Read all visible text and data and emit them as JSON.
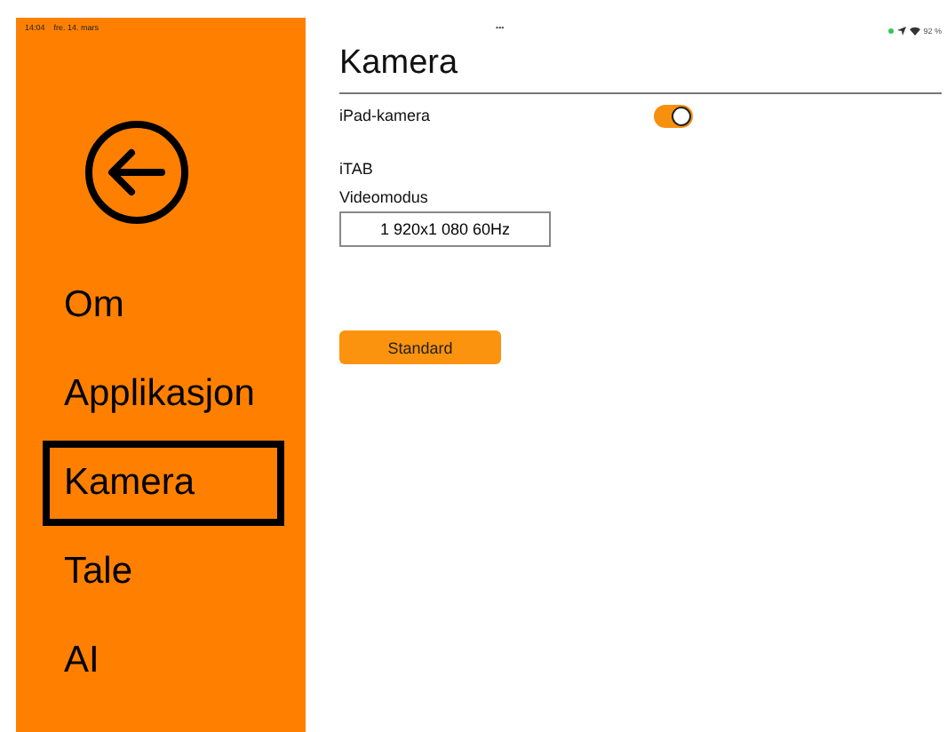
{
  "status_bar": {
    "time": "14:04",
    "date": "fre. 14. mars",
    "dots": "•••",
    "battery": "92 %"
  },
  "sidebar": {
    "items": [
      {
        "label": "Om",
        "selected": false
      },
      {
        "label": "Applikasjon",
        "selected": false
      },
      {
        "label": "Kamera",
        "selected": true
      },
      {
        "label": "Tale",
        "selected": false
      },
      {
        "label": "AI",
        "selected": false
      }
    ]
  },
  "content": {
    "title": "Kamera",
    "toggle": {
      "label": "iPad-kamera",
      "on": true
    },
    "section": "iTAB",
    "video_label": "Videomodus",
    "video_value": "1 920x1 080 60Hz",
    "button": "Standard"
  }
}
